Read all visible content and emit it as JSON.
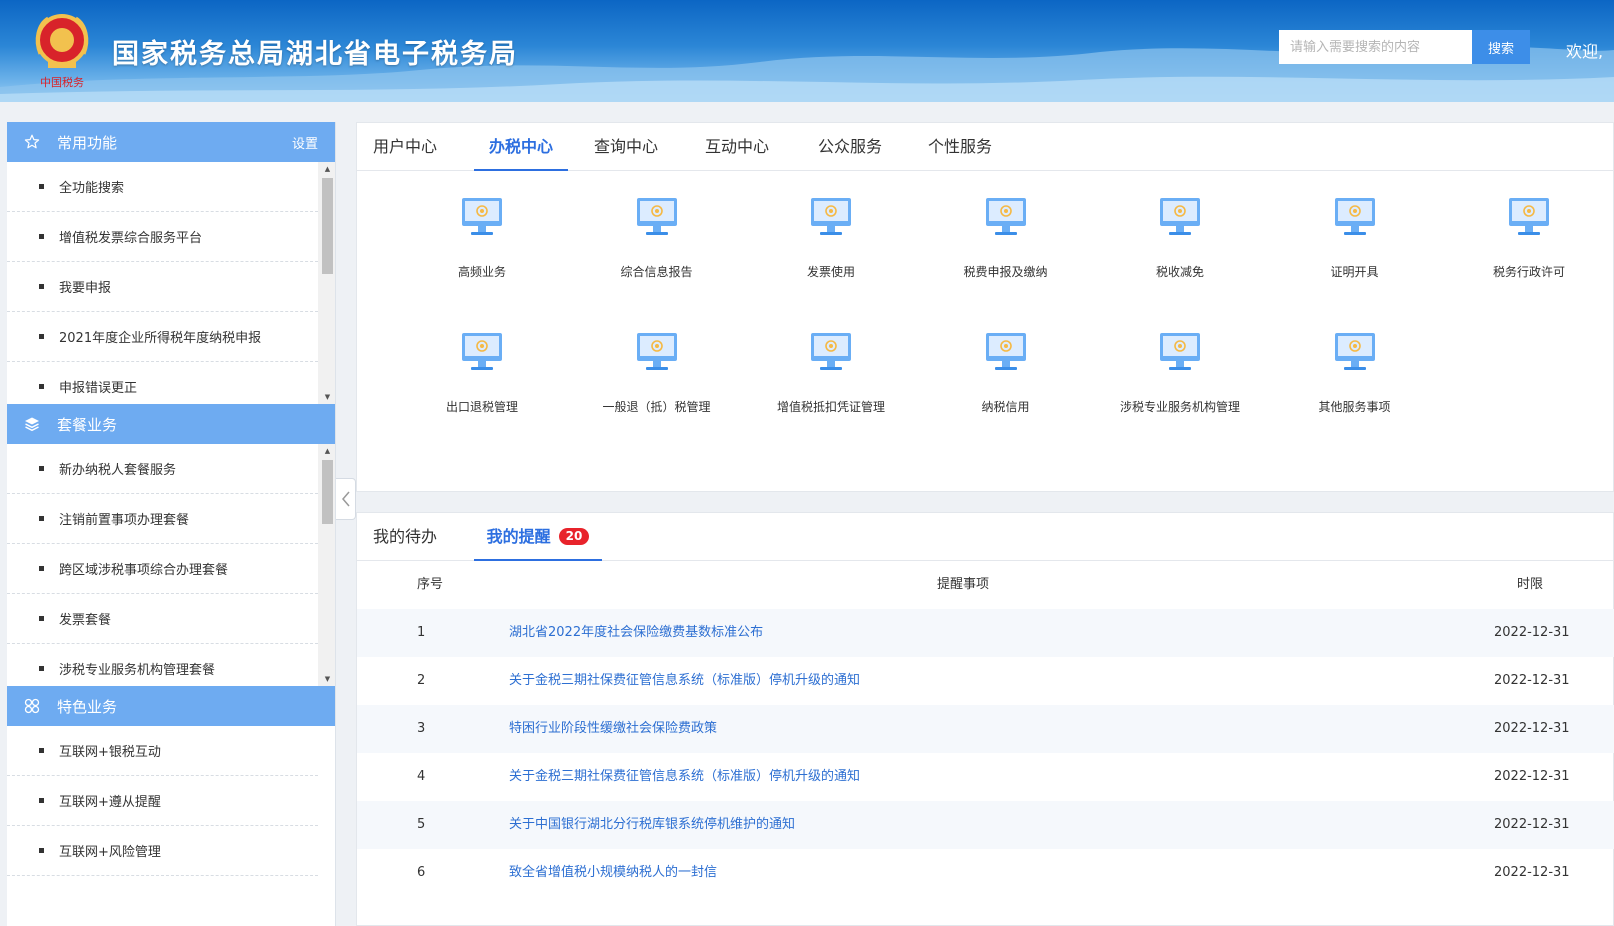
{
  "header": {
    "title": "国家税务总局湖北省电子税务局",
    "logo_caption": "中国税务",
    "search_placeholder": "请输入需要搜索的内容",
    "search_button": "搜索",
    "welcome": "欢迎,"
  },
  "sidebar": {
    "sections": [
      {
        "title": "常用功能",
        "icon": "star-icon",
        "settings_label": "设置",
        "items": [
          "全功能搜索",
          "增值税发票综合服务平台",
          "我要申报",
          "2021年度企业所得税年度纳税申报",
          "申报错误更正"
        ]
      },
      {
        "title": "套餐业务",
        "icon": "layers-icon",
        "items": [
          "新办纳税人套餐服务",
          "注销前置事项办理套餐",
          "跨区域涉税事项综合办理套餐",
          "发票套餐",
          "涉税专业服务机构管理套餐"
        ]
      },
      {
        "title": "特色业务",
        "icon": "grid-icon",
        "items": [
          "互联网+银税互动",
          "互联网+遵从提醒",
          "互联网+风险管理"
        ]
      }
    ]
  },
  "main": {
    "tabs": [
      "用户中心",
      "办税中心",
      "查询中心",
      "互动中心",
      "公众服务",
      "个性服务"
    ],
    "active_tab": "办税中心",
    "functions_row1": [
      "高频业务",
      "综合信息报告",
      "发票使用",
      "税费申报及缴纳",
      "税收减免",
      "证明开具",
      "税务行政许可"
    ],
    "functions_row2": [
      "出口退税管理",
      "一般退（抵）税管理",
      "增值税抵扣凭证管理",
      "纳税信用",
      "涉税专业服务机构管理",
      "其他服务事项"
    ]
  },
  "reminders": {
    "tabs": [
      "我的待办",
      "我的提醒"
    ],
    "badge": "20",
    "columns": [
      "序号",
      "提醒事项",
      "时限"
    ],
    "rows": [
      {
        "no": "1",
        "title": "湖北省2022年度社会保险缴费基数标准公布",
        "date": "2022-12-31"
      },
      {
        "no": "2",
        "title": "关于金税三期社保费征管信息系统（标准版）停机升级的通知",
        "date": "2022-12-31"
      },
      {
        "no": "3",
        "title": "特困行业阶段性缓缴社会保险费政策",
        "date": "2022-12-31"
      },
      {
        "no": "4",
        "title": "关于金税三期社保费征管信息系统（标准版）停机升级的通知",
        "date": "2022-12-31"
      },
      {
        "no": "5",
        "title": "关于中国银行湖北分行税库银系统停机维护的通知",
        "date": "2022-12-31"
      },
      {
        "no": "6",
        "title": "致全省增值税小规模纳税人的一封信",
        "date": "2022-12-31"
      }
    ]
  },
  "colors": {
    "accent": "#2d6fe0",
    "sidebar_header": "#6eabf1",
    "link": "#2d6fd2",
    "badge": "#e8232b"
  }
}
